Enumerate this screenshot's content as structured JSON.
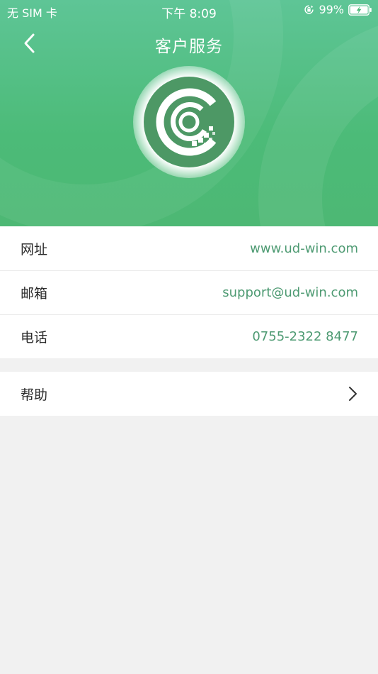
{
  "status_bar": {
    "carrier": "无 SIM 卡",
    "time": "下午 8:09",
    "battery_percent": "99%",
    "icons": [
      "orientation-lock-icon",
      "battery-charging-icon"
    ]
  },
  "nav": {
    "title": "客户服务",
    "back_icon": "chevron-left-icon"
  },
  "logo": {
    "icon": "app-logo-icon"
  },
  "info": {
    "items": [
      {
        "label": "网址",
        "value": "www.ud-win.com"
      },
      {
        "label": "邮箱",
        "value": "support@ud-win.com"
      },
      {
        "label": "电话",
        "value": "0755-2322 8477"
      }
    ]
  },
  "help": {
    "label": "帮助",
    "icon": "chevron-right-icon"
  },
  "colors": {
    "header_green": "#4cbb78",
    "value_green": "#4d9a72",
    "logo_green": "#4d9865",
    "background": "#f1f1f1"
  }
}
